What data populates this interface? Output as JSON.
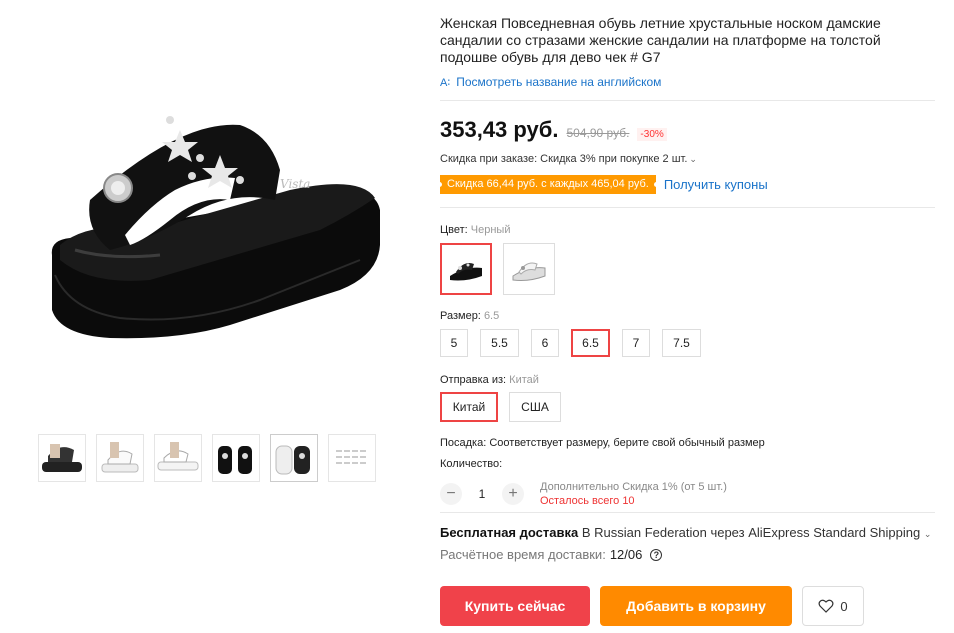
{
  "product": {
    "title": "Женская Повседневная обувь летние хрустальные носком дамские сандалии со стразами женские сандалии на платформе на толстой подошве обувь для дево чек # G7",
    "translate_label": "Посмотреть название на английском",
    "price_current": "353,43 руб.",
    "price_old": "504,90 руб.",
    "price_discount": "-30%",
    "order_discount": "Скидка при заказе: Скидка 3% при покупке 2 шт.",
    "coupon_tag": "Скидка 66,44 руб. с каждых 465,04 руб.",
    "coupon_link": "Получить купоны"
  },
  "color": {
    "label": "Цвет:",
    "value": "Черный",
    "options": [
      "black-sandal",
      "white-sandal"
    ]
  },
  "size": {
    "label": "Размер:",
    "value": "6.5",
    "options": [
      "5",
      "5.5",
      "6",
      "6.5",
      "7",
      "7.5"
    ]
  },
  "ship_from": {
    "label": "Отправка из:",
    "value": "Китай",
    "options": [
      "Китай",
      "США"
    ]
  },
  "fit": "Посадка: Соответствует размеру, берите свой обычный размер",
  "quantity": {
    "label": "Количество:",
    "value": "1",
    "note": "Дополнительно Скидка 1% (от 5 шт.)",
    "stock": "Осталось всего 10"
  },
  "delivery": {
    "free": "Бесплатная доставка",
    "rest": "В Russian Federation через AliExpress Standard Shipping",
    "time_label": "Расчётное время доставки:",
    "time_value": "12/06"
  },
  "actions": {
    "buy": "Купить сейчас",
    "cart": "Добавить в корзину",
    "wish_count": "0"
  },
  "colors": {
    "accent_red": "#f0424a",
    "accent_orange": "#ff8a00",
    "link_blue": "#1a73c9",
    "coupon_orange": "#ff9a00"
  }
}
